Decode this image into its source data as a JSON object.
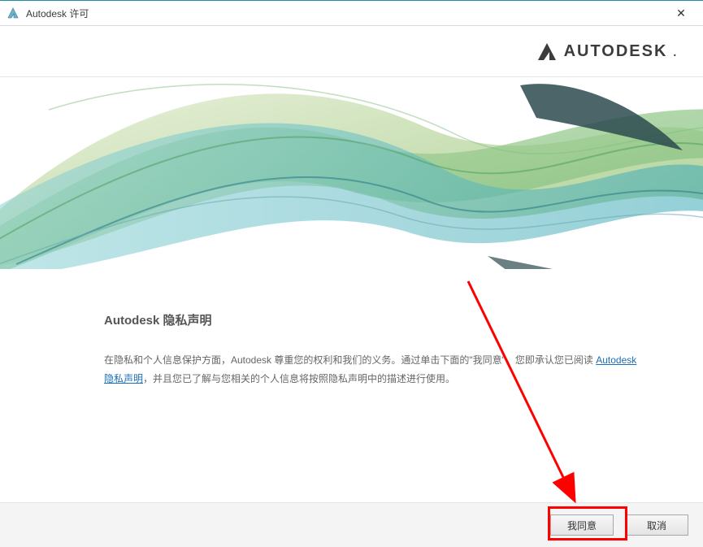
{
  "window": {
    "title": "Autodesk 许可",
    "close_glyph": "✕"
  },
  "brand": {
    "name": "AUTODESK"
  },
  "privacy": {
    "heading": "Autodesk 隐私声明",
    "para_before_link": "在隐私和个人信息保护方面，Autodesk 尊重您的权利和我们的义务。通过单击下面的\"我同意\"，您即承认您已阅读 ",
    "link_text": "Autodesk 隐私声明",
    "para_after_link": "，并且您已了解与您相关的个人信息将按照隐私声明中的描述进行使用。"
  },
  "buttons": {
    "agree": "我同意",
    "cancel": "取消"
  }
}
